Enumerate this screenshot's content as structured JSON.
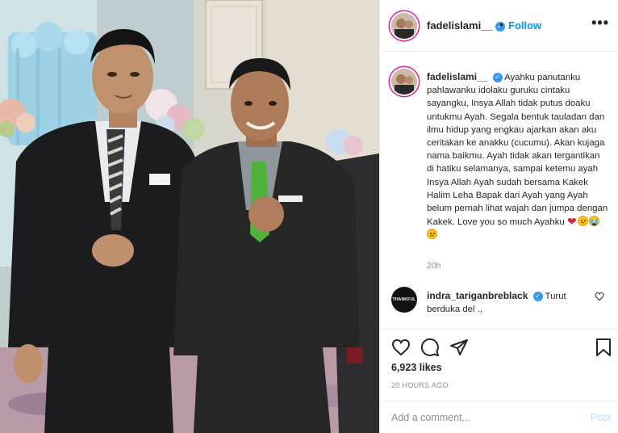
{
  "post": {
    "username": "fadelislami__",
    "follow_label": "Follow",
    "separator": "•",
    "more_label": "•••",
    "verified_mark": "✓"
  },
  "caption": {
    "username": "fadelislami__",
    "text": "Ayahku panutanku pahlawanku idolaku guruku cintaku sayangku, Insya Allah tidak putus doaku untukmu Ayah. Segala bentuk tauladan dan ilmu hidup yang engkau ajarkan akan aku ceritakan ke anakku (cucumu). Akan kujaga nama baikmu. Ayah tidak akan tergantikan di hatiku selamanya, sampai ketemu ayah Insya Allah Ayah sudah bersama Kakek Halim Leha Bapak dari Ayah yang Ayah belum pernah lihat wajah dan jumpa dengan Kakek. Love you so much Ayahku",
    "emojis": [
      "red-heart",
      "grimacing-face",
      "crying-face",
      "frowning-face"
    ],
    "heart_glyph": "❤",
    "time": "20h"
  },
  "comment": {
    "username": "indra_tariganbreblack",
    "text": "Turut berduka del .,",
    "avatar_text": "THANKFUL"
  },
  "actions": {
    "icons": [
      "heart-icon",
      "comment-icon",
      "share-icon",
      "bookmark-icon"
    ]
  },
  "likes": "6,923 likes",
  "timestamp": "20 HOURS AGO",
  "add_comment": {
    "placeholder": "Add a comment...",
    "post_label": "Post"
  },
  "colors": {
    "link_blue": "#0095f6",
    "post_disabled": "#b2dffc",
    "muted": "#8e8e8e",
    "text": "#262626"
  }
}
